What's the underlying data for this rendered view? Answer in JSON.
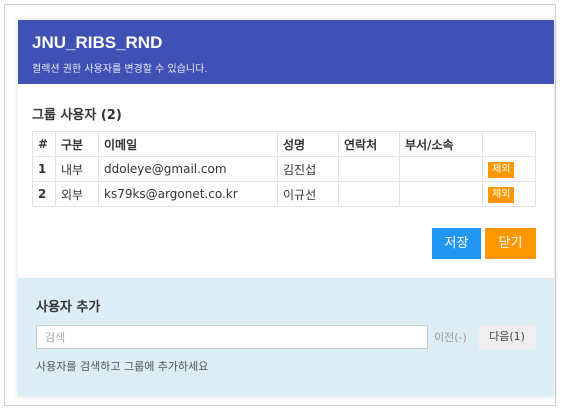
{
  "header": {
    "title": "JNU_RIBS_RND",
    "subtitle": "컬렉션 권한 사용자를 변경할 수 있습니다."
  },
  "group": {
    "title": "그룹 사용자",
    "count": "(2)",
    "columns": [
      "#",
      "구분",
      "이메일",
      "성명",
      "연락처",
      "부서/소속",
      ""
    ],
    "rows": [
      {
        "num": "1",
        "type": "내부",
        "email": "ddoleye@gmail.com",
        "name": "김진섭",
        "phone": "",
        "dept": "",
        "remove_label": "제외"
      },
      {
        "num": "2",
        "type": "외부",
        "email": "ks79ks@argonet.co.kr",
        "name": "이규선",
        "phone": "",
        "dept": "",
        "remove_label": "제외"
      }
    ]
  },
  "actions": {
    "save_label": "저장",
    "close_label": "닫기"
  },
  "add_user": {
    "title": "사용자 추가",
    "search_placeholder": "검색",
    "search_value": "",
    "prev_label": "이전(-)",
    "next_label": "다음(1)",
    "hint": "사용자를 검색하고 그룹에 추가하세요"
  },
  "colors": {
    "header_bg": "#3f51b5",
    "save_bg": "#2196f3",
    "accent_orange": "#ff9800",
    "add_panel_bg": "#dbeef6"
  }
}
